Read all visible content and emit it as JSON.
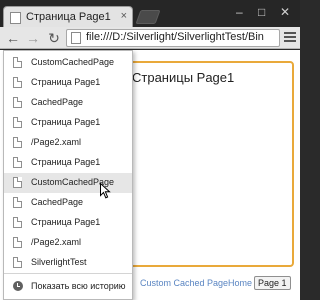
{
  "tab": {
    "title": "Страница Page1",
    "close": "×"
  },
  "window_controls": {
    "minimize": "–",
    "maximize": "□",
    "close": "✕"
  },
  "toolbar": {
    "back": "←",
    "forward": "→",
    "reload": "↻"
  },
  "url": {
    "value": "file:///D:/Silverlight/SilverlightTest/Bin"
  },
  "page": {
    "heading": "Страницы Page1",
    "footer_links": [
      "Custom Cached Page",
      "Home"
    ],
    "footer_button": "Page 1"
  },
  "history": {
    "items": [
      {
        "label": "CustomCachedPage"
      },
      {
        "label": "Страница Page1"
      },
      {
        "label": "CachedPage"
      },
      {
        "label": "Страница Page1"
      },
      {
        "label": "/Page2.xaml"
      },
      {
        "label": "Страница Page1"
      },
      {
        "label": "CustomCachedPage"
      },
      {
        "label": "CachedPage"
      },
      {
        "label": "Страница Page1"
      },
      {
        "label": "/Page2.xaml"
      },
      {
        "label": "SilverlightTest"
      }
    ],
    "hovered_index": 6,
    "show_all_label": "Показать всю историю"
  },
  "colors": {
    "frame_border": "#e9a93a",
    "link": "#5a85c2",
    "titlebar": "#262626"
  }
}
